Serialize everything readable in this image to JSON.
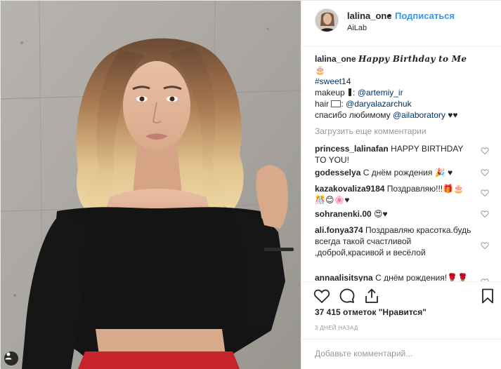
{
  "header": {
    "username": "lalina_one",
    "separator": "•",
    "follow_label": "Подписаться",
    "location": "AiLab"
  },
  "caption": {
    "username": "lalina_one",
    "title_script": "𝓗𝓪𝓹𝓹𝔂 𝓑𝓲𝓻𝓽𝓱𝓭𝓪𝔂 𝓽𝓸 𝓜𝓮",
    "title_plain": "Happy Birthday to Me",
    "title_trailing": "🎂",
    "hashtag": "#sweet14",
    "makeup_label": "makeup",
    "makeup_icon": "💄",
    "makeup_handle": "@artemiy_ir",
    "hair_label": "hair",
    "hair_icon": "💇‍♀️",
    "hair_handle": "@daryalazarchuk",
    "thanks_text": "спасибо любимому",
    "thanks_handle": "@ailaboratory",
    "thanks_hearts": "♥♥"
  },
  "load_more": "Загрузить еще комментарии",
  "comments": [
    {
      "user": "princess_lalinafan",
      "text": "HAPPY BIRTHDAY TO YOU!"
    },
    {
      "user": "godesselya",
      "text": "С днём рождения 🎉 ♥"
    },
    {
      "user": "kazakovaliza9184",
      "text": "Поздравляю!!!🎁🎂 🎊😊🌸♥"
    },
    {
      "user": "sohranenki.00",
      "text": "😍♥"
    },
    {
      "user": "ali.fonya374",
      "text": "Поздравляю красотка.будь всегда такой счастливой ,доброй,красивой и весёлой"
    },
    {
      "user": "annaalisitsyna",
      "text": "С днём рождения!🌹🌹"
    }
  ],
  "likes": "37 415 отметок \"Нравится\"",
  "timestamp": "3 ДНЕЙ НАЗАД",
  "add_comment_placeholder": "Добавьте комментарий...",
  "icons": {
    "like": "heart-icon",
    "comment": "comment-icon",
    "share": "share-icon",
    "save": "bookmark-icon",
    "tag": "user-tag-icon",
    "comment_like": "small-heart-icon"
  },
  "colors": {
    "link": "#003569",
    "follow": "#3897f0",
    "muted": "#999999",
    "text": "#262626"
  }
}
